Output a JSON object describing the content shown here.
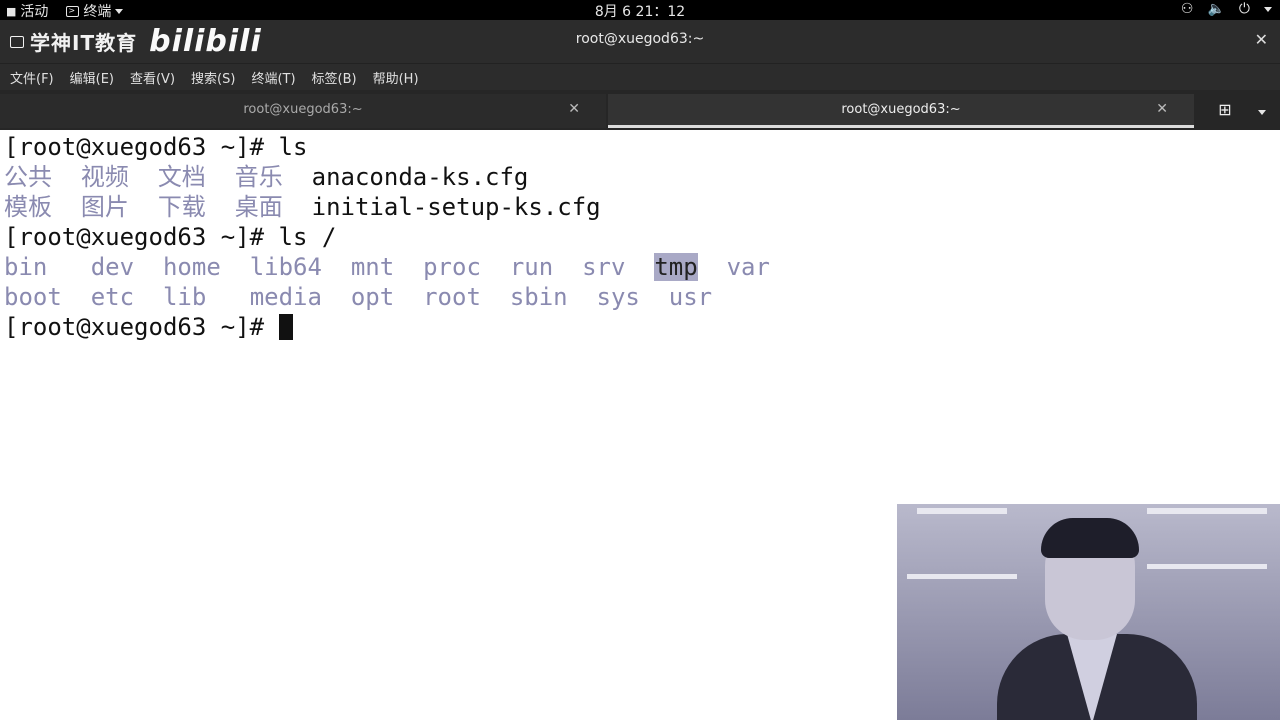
{
  "topbar": {
    "activities": "活动",
    "app_menu": "终端",
    "clock": "8月 6  21：12"
  },
  "window": {
    "title": "root@xuegod63:~",
    "watermark_text": "学神IT教育",
    "watermark_logo": "bilibili"
  },
  "menu": [
    "文件(F)",
    "编辑(E)",
    "查看(V)",
    "搜索(S)",
    "终端(T)",
    "标签(B)",
    "帮助(H)"
  ],
  "tabs": [
    {
      "label": "root@xuegod63:~",
      "active": false
    },
    {
      "label": "root@xuegod63:~",
      "active": true
    }
  ],
  "terminal": {
    "prompt": "[root@xuegod63 ~]# ",
    "cmd1": "ls",
    "ls_home_row1": [
      "公共",
      "视频",
      "文档",
      "音乐"
    ],
    "ls_home_row1_file": "anaconda-ks.cfg",
    "ls_home_row2": [
      "模板",
      "图片",
      "下载",
      "桌面"
    ],
    "ls_home_row2_file": "initial-setup-ks.cfg",
    "cmd2": "ls /",
    "ls_root_row1": [
      "bin",
      "dev",
      "home",
      "lib64",
      "mnt",
      "proc",
      "run",
      "srv",
      "tmp",
      "var"
    ],
    "ls_root_row2": [
      "boot",
      "etc",
      "lib",
      "media",
      "opt",
      "root",
      "sbin",
      "sys",
      "usr"
    ],
    "highlighted": "tmp"
  },
  "colors": {
    "dir": "#8a8ab0",
    "highlight": "#a9a9c6",
    "terminal_bg": "#ffffff",
    "chrome_bg": "#2c2c2c"
  }
}
